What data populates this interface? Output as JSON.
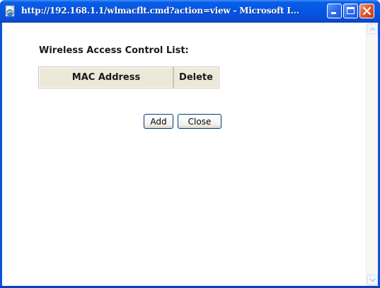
{
  "window": {
    "title": "http://192.168.1.1/wlmacflt.cmd?action=view - Microsoft I..."
  },
  "page": {
    "heading": "Wireless Access Control List:",
    "table": {
      "columns": [
        "MAC Address",
        "Delete"
      ],
      "rows": []
    },
    "buttons": {
      "add": "Add",
      "close": "Close"
    }
  },
  "icons": {
    "app": "ie-page-icon",
    "minimize": "minimize-icon",
    "maximize": "maximize-icon",
    "close": "close-icon",
    "scroll_up": "chevron-up-icon",
    "scroll_down": "chevron-down-icon"
  },
  "colors": {
    "titlebar": "#0455e3",
    "header_cell": "#ece9d8",
    "close_button": "#e1582f"
  }
}
